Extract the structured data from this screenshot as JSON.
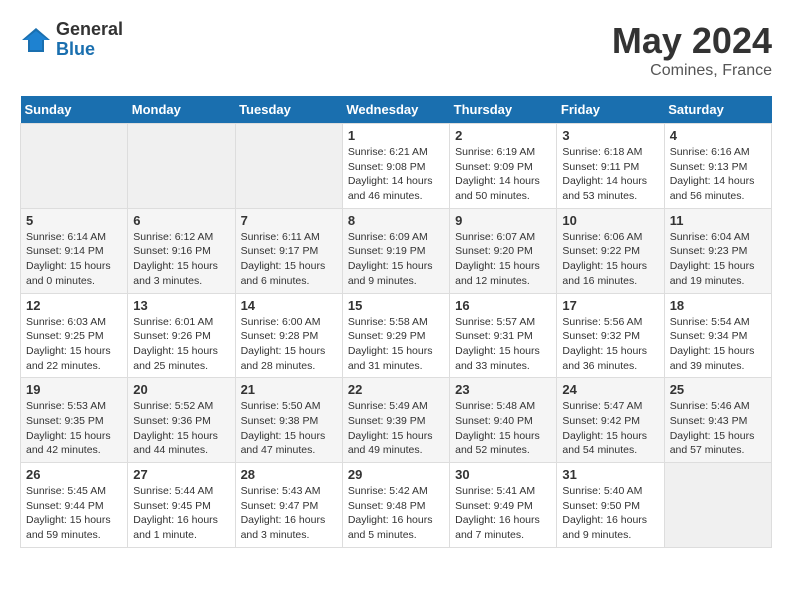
{
  "header": {
    "logo_general": "General",
    "logo_blue": "Blue",
    "title": "May 2024",
    "subtitle": "Comines, France"
  },
  "days_of_week": [
    "Sunday",
    "Monday",
    "Tuesday",
    "Wednesday",
    "Thursday",
    "Friday",
    "Saturday"
  ],
  "weeks": [
    [
      {
        "day": "",
        "empty": true
      },
      {
        "day": "",
        "empty": true
      },
      {
        "day": "",
        "empty": true
      },
      {
        "day": "1",
        "sunrise": "Sunrise: 6:21 AM",
        "sunset": "Sunset: 9:08 PM",
        "daylight": "Daylight: 14 hours and 46 minutes."
      },
      {
        "day": "2",
        "sunrise": "Sunrise: 6:19 AM",
        "sunset": "Sunset: 9:09 PM",
        "daylight": "Daylight: 14 hours and 50 minutes."
      },
      {
        "day": "3",
        "sunrise": "Sunrise: 6:18 AM",
        "sunset": "Sunset: 9:11 PM",
        "daylight": "Daylight: 14 hours and 53 minutes."
      },
      {
        "day": "4",
        "sunrise": "Sunrise: 6:16 AM",
        "sunset": "Sunset: 9:13 PM",
        "daylight": "Daylight: 14 hours and 56 minutes."
      }
    ],
    [
      {
        "day": "5",
        "sunrise": "Sunrise: 6:14 AM",
        "sunset": "Sunset: 9:14 PM",
        "daylight": "Daylight: 15 hours and 0 minutes."
      },
      {
        "day": "6",
        "sunrise": "Sunrise: 6:12 AM",
        "sunset": "Sunset: 9:16 PM",
        "daylight": "Daylight: 15 hours and 3 minutes."
      },
      {
        "day": "7",
        "sunrise": "Sunrise: 6:11 AM",
        "sunset": "Sunset: 9:17 PM",
        "daylight": "Daylight: 15 hours and 6 minutes."
      },
      {
        "day": "8",
        "sunrise": "Sunrise: 6:09 AM",
        "sunset": "Sunset: 9:19 PM",
        "daylight": "Daylight: 15 hours and 9 minutes."
      },
      {
        "day": "9",
        "sunrise": "Sunrise: 6:07 AM",
        "sunset": "Sunset: 9:20 PM",
        "daylight": "Daylight: 15 hours and 12 minutes."
      },
      {
        "day": "10",
        "sunrise": "Sunrise: 6:06 AM",
        "sunset": "Sunset: 9:22 PM",
        "daylight": "Daylight: 15 hours and 16 minutes."
      },
      {
        "day": "11",
        "sunrise": "Sunrise: 6:04 AM",
        "sunset": "Sunset: 9:23 PM",
        "daylight": "Daylight: 15 hours and 19 minutes."
      }
    ],
    [
      {
        "day": "12",
        "sunrise": "Sunrise: 6:03 AM",
        "sunset": "Sunset: 9:25 PM",
        "daylight": "Daylight: 15 hours and 22 minutes."
      },
      {
        "day": "13",
        "sunrise": "Sunrise: 6:01 AM",
        "sunset": "Sunset: 9:26 PM",
        "daylight": "Daylight: 15 hours and 25 minutes."
      },
      {
        "day": "14",
        "sunrise": "Sunrise: 6:00 AM",
        "sunset": "Sunset: 9:28 PM",
        "daylight": "Daylight: 15 hours and 28 minutes."
      },
      {
        "day": "15",
        "sunrise": "Sunrise: 5:58 AM",
        "sunset": "Sunset: 9:29 PM",
        "daylight": "Daylight: 15 hours and 31 minutes."
      },
      {
        "day": "16",
        "sunrise": "Sunrise: 5:57 AM",
        "sunset": "Sunset: 9:31 PM",
        "daylight": "Daylight: 15 hours and 33 minutes."
      },
      {
        "day": "17",
        "sunrise": "Sunrise: 5:56 AM",
        "sunset": "Sunset: 9:32 PM",
        "daylight": "Daylight: 15 hours and 36 minutes."
      },
      {
        "day": "18",
        "sunrise": "Sunrise: 5:54 AM",
        "sunset": "Sunset: 9:34 PM",
        "daylight": "Daylight: 15 hours and 39 minutes."
      }
    ],
    [
      {
        "day": "19",
        "sunrise": "Sunrise: 5:53 AM",
        "sunset": "Sunset: 9:35 PM",
        "daylight": "Daylight: 15 hours and 42 minutes."
      },
      {
        "day": "20",
        "sunrise": "Sunrise: 5:52 AM",
        "sunset": "Sunset: 9:36 PM",
        "daylight": "Daylight: 15 hours and 44 minutes."
      },
      {
        "day": "21",
        "sunrise": "Sunrise: 5:50 AM",
        "sunset": "Sunset: 9:38 PM",
        "daylight": "Daylight: 15 hours and 47 minutes."
      },
      {
        "day": "22",
        "sunrise": "Sunrise: 5:49 AM",
        "sunset": "Sunset: 9:39 PM",
        "daylight": "Daylight: 15 hours and 49 minutes."
      },
      {
        "day": "23",
        "sunrise": "Sunrise: 5:48 AM",
        "sunset": "Sunset: 9:40 PM",
        "daylight": "Daylight: 15 hours and 52 minutes."
      },
      {
        "day": "24",
        "sunrise": "Sunrise: 5:47 AM",
        "sunset": "Sunset: 9:42 PM",
        "daylight": "Daylight: 15 hours and 54 minutes."
      },
      {
        "day": "25",
        "sunrise": "Sunrise: 5:46 AM",
        "sunset": "Sunset: 9:43 PM",
        "daylight": "Daylight: 15 hours and 57 minutes."
      }
    ],
    [
      {
        "day": "26",
        "sunrise": "Sunrise: 5:45 AM",
        "sunset": "Sunset: 9:44 PM",
        "daylight": "Daylight: 15 hours and 59 minutes."
      },
      {
        "day": "27",
        "sunrise": "Sunrise: 5:44 AM",
        "sunset": "Sunset: 9:45 PM",
        "daylight": "Daylight: 16 hours and 1 minute."
      },
      {
        "day": "28",
        "sunrise": "Sunrise: 5:43 AM",
        "sunset": "Sunset: 9:47 PM",
        "daylight": "Daylight: 16 hours and 3 minutes."
      },
      {
        "day": "29",
        "sunrise": "Sunrise: 5:42 AM",
        "sunset": "Sunset: 9:48 PM",
        "daylight": "Daylight: 16 hours and 5 minutes."
      },
      {
        "day": "30",
        "sunrise": "Sunrise: 5:41 AM",
        "sunset": "Sunset: 9:49 PM",
        "daylight": "Daylight: 16 hours and 7 minutes."
      },
      {
        "day": "31",
        "sunrise": "Sunrise: 5:40 AM",
        "sunset": "Sunset: 9:50 PM",
        "daylight": "Daylight: 16 hours and 9 minutes."
      },
      {
        "day": "",
        "empty": true
      }
    ]
  ]
}
